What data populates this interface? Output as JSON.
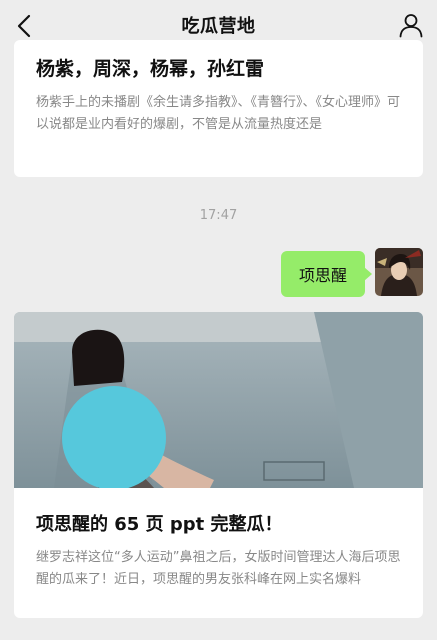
{
  "header": {
    "title": "吃瓜营地",
    "back_icon": "chevron-left-icon",
    "profile_icon": "person-icon"
  },
  "article1": {
    "title": "杨紫，周深，杨幂，孙红雷",
    "summary": "杨紫手上的未播剧《余生请多指教》、《青簪行》、《女心理师》可以说都是业内看好的爆剧，不管是从流量热度还是"
  },
  "timestamp": "17:47",
  "message": {
    "text": "项思醒",
    "bubble_color": "#95ec69"
  },
  "article2": {
    "title": "项思醒的 65 页 ppt 完整瓜！",
    "summary": "继罗志祥这位“多人运动”鼻祖之后，女版时间管理达人海后项思醒的瓜来了！近日，项思醒的男友张科峰在网上实名爆料"
  },
  "colors": {
    "background": "#ededed",
    "card": "#ffffff",
    "blur_circle": "#56c8dc"
  }
}
